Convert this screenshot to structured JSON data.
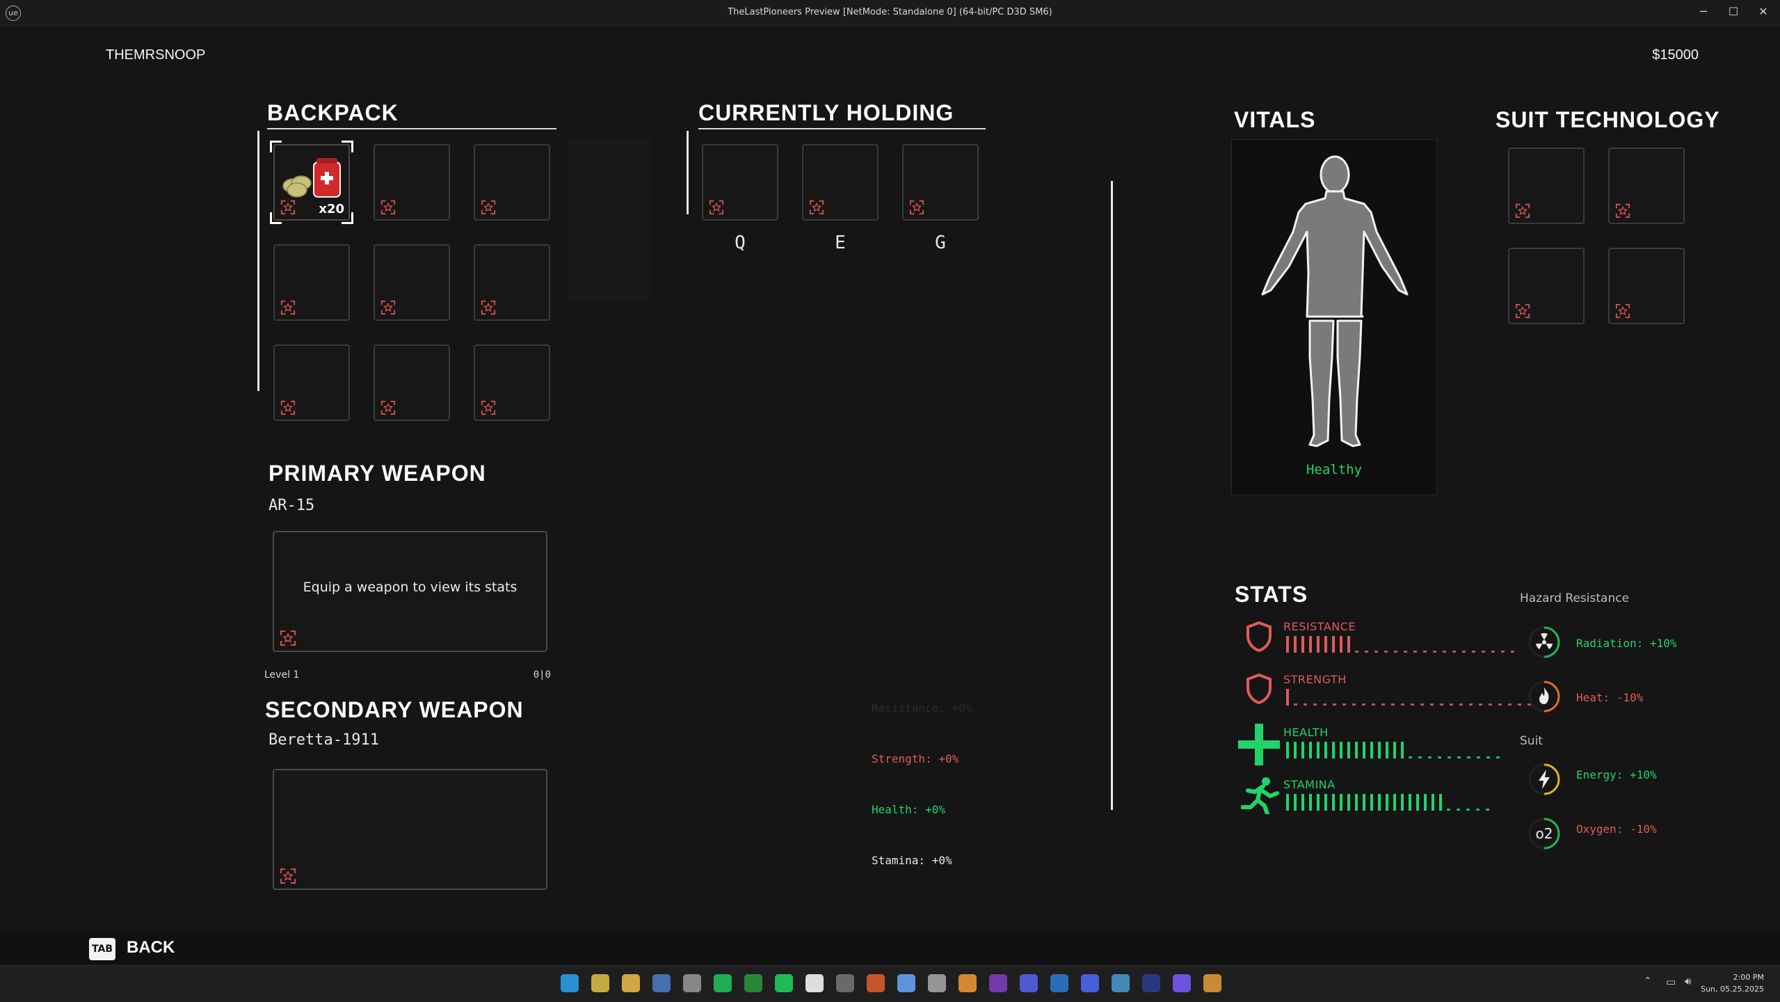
{
  "window": {
    "title": "TheLastPioneers Preview [NetMode: Standalone 0]  (64-bit/PC D3D SM6)",
    "logo": "ue",
    "controls": [
      "─",
      "☐",
      "✕"
    ]
  },
  "header": {
    "player_name": "THEMRSNOOP",
    "money": "$15000"
  },
  "backpack": {
    "title": "BACKPACK",
    "first_item_count": "x20"
  },
  "holding": {
    "title": "CURRENTLY HOLDING",
    "keys": [
      "Q",
      "E",
      "G"
    ]
  },
  "primary_weapon": {
    "title": "PRIMARY WEAPON",
    "name": "AR-15",
    "hint": "Equip a weapon to view its stats",
    "level": "Level 1",
    "ammo": "0|0"
  },
  "secondary_weapon": {
    "title": "SECONDARY WEAPON",
    "name": "Beretta-1911"
  },
  "modifiers": {
    "resistance": "Resistance: +0%",
    "strength": "Strength: +0%",
    "health": "Health: +0%",
    "stamina": "Stamina: +0%"
  },
  "vitals": {
    "title": "VITALS",
    "status": "Healthy"
  },
  "suit_tech": {
    "title": "SUIT TECHNOLOGY"
  },
  "stats": {
    "title": "STATS",
    "resistance": {
      "label": "RESISTANCE",
      "level": 0.33
    },
    "strength": {
      "label": "STRENGTH",
      "level": 0.05
    },
    "health": {
      "label": "HEALTH",
      "level": 0.6
    },
    "stamina": {
      "label": "STAMINA",
      "level": 0.8
    }
  },
  "hazard": {
    "title": "Hazard Resistance",
    "radiation": "Radiation: +10%",
    "heat": "Heat: -10%",
    "suit_title": "Suit",
    "energy": "Energy: +10%",
    "oxygen": "Oxygen: -10%",
    "oxygen_icon": "o2"
  },
  "footer": {
    "key": "TAB",
    "back_label": "BACK"
  },
  "taskbar": {
    "time": "2:00 PM",
    "date": "Sun, 05.25.2025"
  },
  "colors": {
    "red": "#e05a5a",
    "green": "#22d36a",
    "yellow": "#e0b020"
  }
}
